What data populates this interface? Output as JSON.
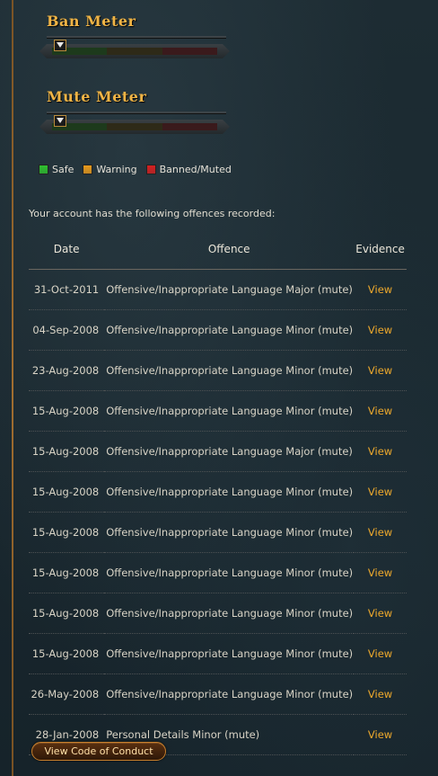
{
  "ban_meter": {
    "title": "Ban Meter",
    "level": 0.05
  },
  "mute_meter": {
    "title": "Mute Meter",
    "level": 0.05
  },
  "legend": [
    {
      "label": "Safe",
      "color": "#2fbf2f"
    },
    {
      "label": "Warning",
      "color": "#e89a1c"
    },
    {
      "label": "Banned/Muted",
      "color": "#d42020"
    }
  ],
  "intro_text": "Your account has the following offences recorded:",
  "table": {
    "headers": {
      "date": "Date",
      "offence": "Offence",
      "evidence": "Evidence"
    },
    "rows": [
      {
        "date": "31-Oct-2011",
        "offence": "Offensive/Inappropriate Language Major (mute)",
        "evidence": "View"
      },
      {
        "date": "04-Sep-2008",
        "offence": "Offensive/Inappropriate Language Minor (mute)",
        "evidence": "View"
      },
      {
        "date": "23-Aug-2008",
        "offence": "Offensive/Inappropriate Language Minor (mute)",
        "evidence": "View"
      },
      {
        "date": "15-Aug-2008",
        "offence": "Offensive/Inappropriate Language Minor (mute)",
        "evidence": "View"
      },
      {
        "date": "15-Aug-2008",
        "offence": "Offensive/Inappropriate Language Major (mute)",
        "evidence": "View"
      },
      {
        "date": "15-Aug-2008",
        "offence": "Offensive/Inappropriate Language Minor (mute)",
        "evidence": "View"
      },
      {
        "date": "15-Aug-2008",
        "offence": "Offensive/Inappropriate Language Minor (mute)",
        "evidence": "View"
      },
      {
        "date": "15-Aug-2008",
        "offence": "Offensive/Inappropriate Language Minor (mute)",
        "evidence": "View"
      },
      {
        "date": "15-Aug-2008",
        "offence": "Offensive/Inappropriate Language Minor (mute)",
        "evidence": "View"
      },
      {
        "date": "15-Aug-2008",
        "offence": "Offensive/Inappropriate Language Minor (mute)",
        "evidence": "View"
      },
      {
        "date": "26-May-2008",
        "offence": "Offensive/Inappropriate Language Minor (mute)",
        "evidence": "View"
      },
      {
        "date": "28-Jan-2008",
        "offence": "Personal Details Minor (mute)",
        "evidence": "View"
      }
    ]
  },
  "code_of_conduct_button": "View Code of Conduct"
}
